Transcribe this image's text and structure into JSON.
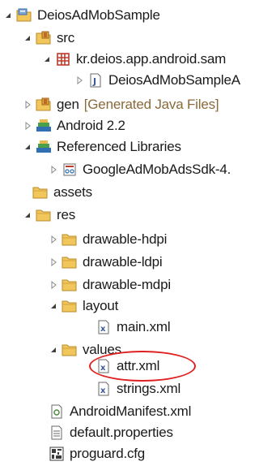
{
  "tree": {
    "root_label": "DeiosAdMobSample",
    "src_label": "src",
    "package_label": "kr.deios.app.android.sam",
    "java_file_label": "DeiosAdMobSampleA",
    "gen_label": "gen",
    "gen_decoration": "[Generated Java Files]",
    "android_label": "Android 2.2",
    "ref_libs_label": "Referenced Libraries",
    "jar_label": "GoogleAdMobAdsSdk-4.",
    "assets_label": "assets",
    "res_label": "res",
    "drawable_hdpi_label": "drawable-hdpi",
    "drawable_ldpi_label": "drawable-ldpi",
    "drawable_mdpi_label": "drawable-mdpi",
    "layout_label": "layout",
    "main_xml_label": "main.xml",
    "values_label": "values",
    "attr_xml_label": "attr.xml",
    "strings_xml_label": "strings.xml",
    "manifest_label": "AndroidManifest.xml",
    "default_props_label": "default.properties",
    "proguard_label": "proguard.cfg"
  },
  "icons": {
    "project": "project-folder-icon",
    "source_folder": "source-folder-icon",
    "package": "package-icon",
    "java_file": "java-file-icon",
    "library": "library-icon",
    "jar": "jar-icon",
    "folder": "folder-icon",
    "xml_file": "xml-file-icon",
    "manifest": "manifest-file-icon",
    "properties": "text-file-icon",
    "cfg": "config-file-icon"
  },
  "colors": {
    "highlight": "#e02020",
    "decoration_text": "#8a6a3a",
    "folder": "#e8b84a",
    "package": "#c0392b",
    "library": "#2f6fb2"
  }
}
